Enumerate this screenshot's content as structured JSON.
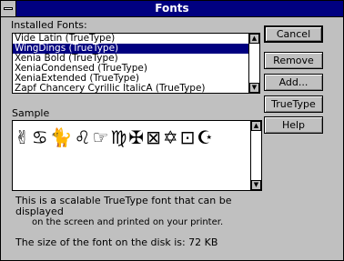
{
  "window": {
    "title": "Fonts"
  },
  "installed": {
    "label": "Installed Fonts:",
    "items": [
      "Vide Latin (TrueType)",
      "WingDings (TrueType)",
      "Xenia Bold (TrueType)",
      "XeniaCondensed (TrueType)",
      "XeniaExtended (TrueType)",
      "Zapf Chancery Cyrillic ItalicA (TrueType)"
    ],
    "selected_index": 1
  },
  "buttons": {
    "cancel": "Cancel",
    "remove": "Remove",
    "add": "Add...",
    "truetype": "TrueType",
    "help": "Help"
  },
  "sample": {
    "label": "Sample",
    "glyphs": "✌♋🐈♌☞♍✠⊠✡⊡☪"
  },
  "description": {
    "line1": "This is a scalable TrueType font that can be displayed",
    "line2": "on the screen and printed on your printer."
  },
  "size_text": "The size of the font on the disk is:  72 KB"
}
